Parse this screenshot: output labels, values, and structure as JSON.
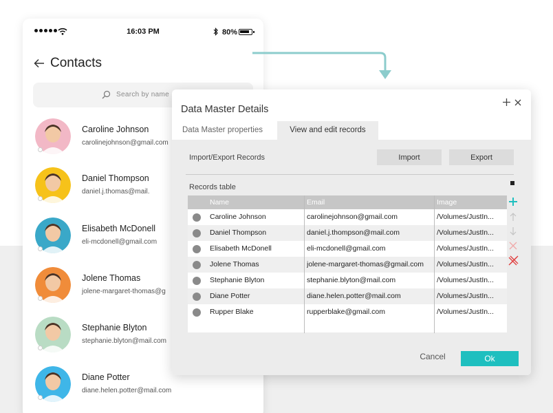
{
  "phone": {
    "status": {
      "time": "16:03 PM",
      "battery": "80%"
    },
    "title": "Contacts",
    "search_placeholder": "Search by name",
    "contacts": [
      {
        "name": "Caroline Johnson",
        "email": "carolinejohnson@gmail.com",
        "bg": "#f2b8c6"
      },
      {
        "name": "Daniel Thompson",
        "email": "daniel.j.thomas@mail.",
        "bg": "#f6c21a"
      },
      {
        "name": "Elisabeth McDonell",
        "email": "eli-mcdonell@gmail.com",
        "bg": "#3aa8c8"
      },
      {
        "name": "Jolene Thomas",
        "email": "jolene-margaret-thomas@g",
        "bg": "#f08c3a"
      },
      {
        "name": "Stephanie Blyton",
        "email": "stephanie.blyton@mail.com",
        "bg": "#b9dcc4"
      },
      {
        "name": "Diane Potter",
        "email": "diane.helen.potter@mail.com",
        "bg": "#3fb6e8"
      }
    ]
  },
  "dialog": {
    "title": "Data Master Details",
    "tabs": [
      "Data Master properties",
      "View and edit records"
    ],
    "import_export_label": "Import/Export Records",
    "import_label": "Import",
    "export_label": "Export",
    "records_label": "Records table",
    "columns": [
      "Name",
      "Email",
      "Image"
    ],
    "rows": [
      {
        "name": "Caroline Johnson",
        "email": "carolinejohnson@gmail.com",
        "image": "/Volumes/JustIn..."
      },
      {
        "name": "Daniel Thompson",
        "email": "daniel.j.thompson@mail.com",
        "image": "/Volumes/JustIn..."
      },
      {
        "name": "Elisabeth McDonell",
        "email": "eli-mcdonell@gmail.com",
        "image": "/Volumes/JustIn..."
      },
      {
        "name": "Jolene Thomas",
        "email": "jolene-margaret-thomas@gmail.com",
        "image": "/Volumes/JustIn..."
      },
      {
        "name": "Stephanie Blyton",
        "email": "stephanie.blyton@mail.com",
        "image": "/Volumes/JustIn..."
      },
      {
        "name": "Diane Potter",
        "email": "diane.helen.potter@mail.com",
        "image": "/Volumes/JustIn..."
      },
      {
        "name": "Rupper Blake",
        "email": "rupperblake@gmail.com",
        "image": "/Volumes/JustIn..."
      }
    ],
    "cancel_label": "Cancel",
    "ok_label": "Ok"
  },
  "colors": {
    "accent": "#1ebfbf",
    "connector": "#8ccccc",
    "delete": "#e03a3a"
  }
}
